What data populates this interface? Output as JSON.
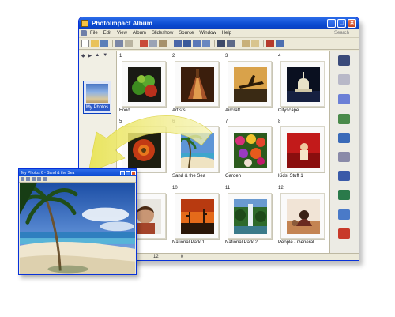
{
  "window": {
    "title": "PhotoImpact Album",
    "buttons": {
      "minimize": "_",
      "maximize": "□",
      "close": "✕"
    }
  },
  "menubar": {
    "items": [
      "File",
      "Edit",
      "View",
      "Album",
      "Slideshow",
      "Source",
      "Window",
      "Help"
    ],
    "search_label": "Search"
  },
  "left_pane": {
    "tools": [
      "◆",
      "▶",
      "▲",
      "▼"
    ],
    "album_label": "My Photos"
  },
  "thumbnails": [
    {
      "number": "1",
      "caption": "Food",
      "photo": "food"
    },
    {
      "number": "2",
      "caption": "Artists",
      "photo": "artists"
    },
    {
      "number": "3",
      "caption": "Aircraft",
      "photo": "aircraft"
    },
    {
      "number": "4",
      "caption": "Cityscape",
      "photo": "cityscape"
    },
    {
      "number": "5",
      "caption": "",
      "photo": "flower-red"
    },
    {
      "number": "6",
      "caption": "Sand & the Sea",
      "photo": "beach"
    },
    {
      "number": "7",
      "caption": "Garden",
      "photo": "garden"
    },
    {
      "number": "8",
      "caption": "Kids' Stuff 1",
      "photo": "kids"
    },
    {
      "number": "",
      "caption": "",
      "photo": "child"
    },
    {
      "number": "10",
      "caption": "National Park 1",
      "photo": "desert-sunset"
    },
    {
      "number": "11",
      "caption": "National Park 2",
      "photo": "waterfall"
    },
    {
      "number": "12",
      "caption": "People - General",
      "photo": "people"
    }
  ],
  "status_bar": [
    "1",
    "12",
    "12",
    "0"
  ],
  "right_pane_icons": [
    "binoculars-icon",
    "scanner-icon",
    "email-icon",
    "slideshow-icon",
    "monitor-icon",
    "printer-icon",
    "camera-icon",
    "presentation-icon",
    "web-icon",
    "paint-icon"
  ],
  "mini_window": {
    "title": "My Photos 6 - Sand & the Sea"
  }
}
